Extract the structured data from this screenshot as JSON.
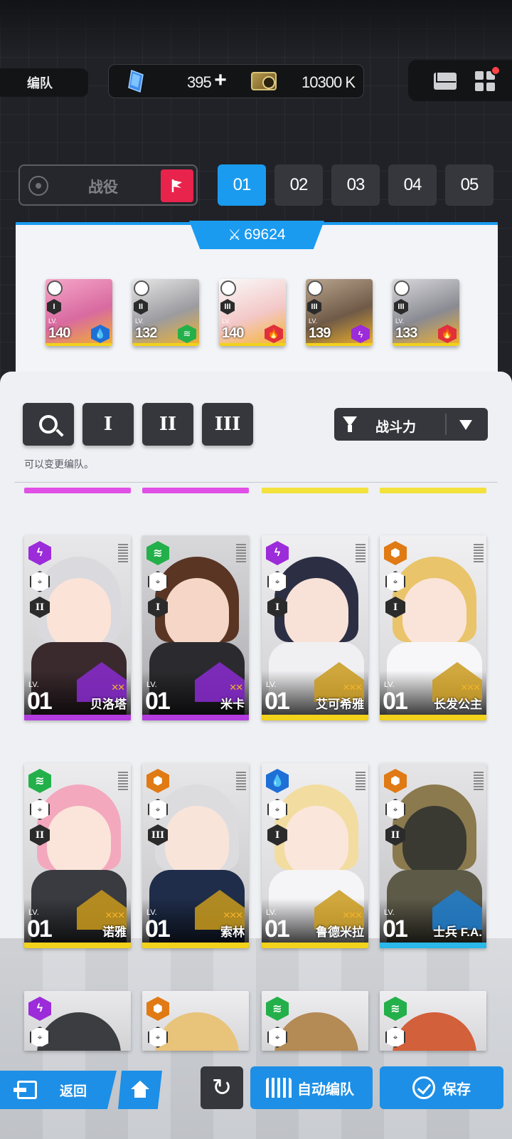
{
  "header": {
    "page_label": "编队",
    "gems": "395",
    "plus": "+",
    "credits": "10300 K"
  },
  "campaign": {
    "label": "战役"
  },
  "team_tabs": [
    "01",
    "02",
    "03",
    "04",
    "05"
  ],
  "active_team": "01",
  "squad": {
    "power": "69624",
    "members": [
      {
        "burst": "I",
        "lv_tag": "LV.",
        "level": "140",
        "element": "water",
        "color": "#1e6fd6"
      },
      {
        "burst": "II",
        "lv_tag": "LV.",
        "level": "132",
        "element": "wind",
        "color": "#23b04a"
      },
      {
        "burst": "III",
        "lv_tag": "LV.",
        "level": "140",
        "element": "fire",
        "color": "#e0303a"
      },
      {
        "burst": "III",
        "lv_tag": "LV.",
        "level": "139",
        "element": "electric",
        "color": "#9c2bd9"
      },
      {
        "burst": "III",
        "lv_tag": "LV.",
        "level": "133",
        "element": "fire",
        "color": "#e0303a"
      }
    ]
  },
  "filters": {
    "search_icon": "search-icon",
    "burst_1": "I",
    "burst_2": "II",
    "burst_3": "III",
    "sort_label": "战斗力"
  },
  "hint": "可以变更编队。",
  "characters": [
    {
      "name": "贝洛塔",
      "lv_tag": "LV.",
      "level": "01",
      "burst": "II",
      "element": "electric",
      "elem_color": "#9c2bd9",
      "rarity": "purple",
      "rarity_color": "#b43be0"
    },
    {
      "name": "米卡",
      "lv_tag": "LV.",
      "level": "01",
      "burst": "I",
      "element": "wind",
      "elem_color": "#23b04a",
      "rarity": "purple",
      "rarity_color": "#b43be0"
    },
    {
      "name": "艾可希雅",
      "lv_tag": "LV.",
      "level": "01",
      "burst": "I",
      "element": "electric",
      "elem_color": "#9c2bd9",
      "rarity": "gold",
      "rarity_color": "#f2d21b"
    },
    {
      "name": "长发公主",
      "lv_tag": "LV.",
      "level": "01",
      "burst": "I",
      "element": "iron",
      "elem_color": "#e07a14",
      "rarity": "gold",
      "rarity_color": "#f2d21b"
    },
    {
      "name": "诺雅",
      "lv_tag": "LV.",
      "level": "01",
      "burst": "II",
      "element": "wind",
      "elem_color": "#23b04a",
      "rarity": "gold",
      "rarity_color": "#f2d21b"
    },
    {
      "name": "索林",
      "lv_tag": "LV.",
      "level": "01",
      "burst": "III",
      "element": "iron",
      "elem_color": "#e07a14",
      "rarity": "gold",
      "rarity_color": "#f2d21b"
    },
    {
      "name": "鲁德米拉",
      "lv_tag": "LV.",
      "level": "01",
      "burst": "I",
      "element": "water",
      "elem_color": "#1e6fd6",
      "rarity": "gold",
      "rarity_color": "#f2d21b"
    },
    {
      "name": "士兵 F.A.",
      "lv_tag": "LV.",
      "level": "01",
      "burst": "II",
      "element": "iron",
      "elem_color": "#e07a14",
      "rarity": "blue",
      "rarity_color": "#29b8e8"
    }
  ],
  "partial_row": [
    {
      "element": "electric",
      "elem_color": "#9c2bd9"
    },
    {
      "element": "iron",
      "elem_color": "#e07a14"
    },
    {
      "element": "wind",
      "elem_color": "#23b04a"
    },
    {
      "element": "wind",
      "elem_color": "#23b04a"
    }
  ],
  "bottom_nav": {
    "back": "返回",
    "auto_team": "自动编队",
    "save": "保存"
  }
}
